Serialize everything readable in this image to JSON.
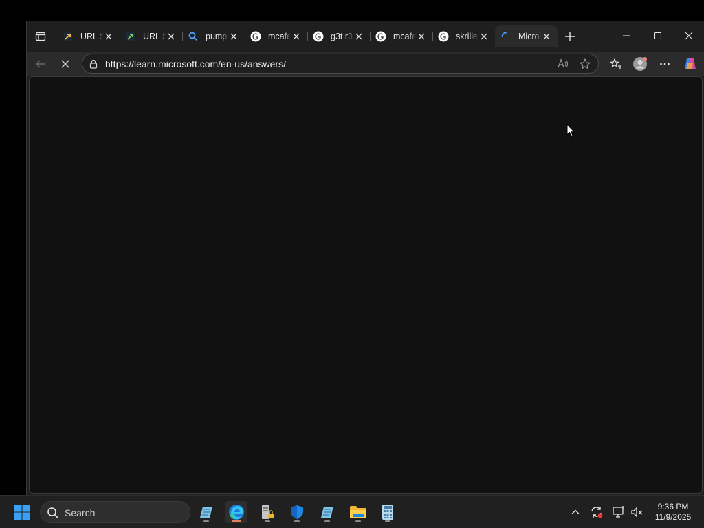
{
  "browser": {
    "tabs": [
      {
        "title": "URL S",
        "favicon": "arrow-app-icon",
        "active": false
      },
      {
        "title": "URL S",
        "favicon": "arrow-app-icon",
        "active": false
      },
      {
        "title": "pump",
        "favicon": "search-icon",
        "active": false
      },
      {
        "title": "mcafe",
        "favicon": "google-icon",
        "active": false
      },
      {
        "title": "g3t r3",
        "favicon": "google-icon",
        "active": false
      },
      {
        "title": "mcafe",
        "favicon": "google-icon",
        "active": false
      },
      {
        "title": "skrille",
        "favicon": "google-icon",
        "active": false
      },
      {
        "title": "Micro",
        "favicon": "loading-spinner-icon",
        "active": true
      }
    ],
    "address": {
      "url": "https://learn.microsoft.com/en-us/answers/"
    },
    "colors": {
      "content_bg": "#111111",
      "toolbar_bg": "#2b2b2b",
      "tabstrip_bg": "#1f1f1f"
    }
  },
  "taskbar": {
    "search_placeholder": "Search",
    "clock": {
      "time": "9:36 PM",
      "date": "11/9/2025"
    }
  }
}
